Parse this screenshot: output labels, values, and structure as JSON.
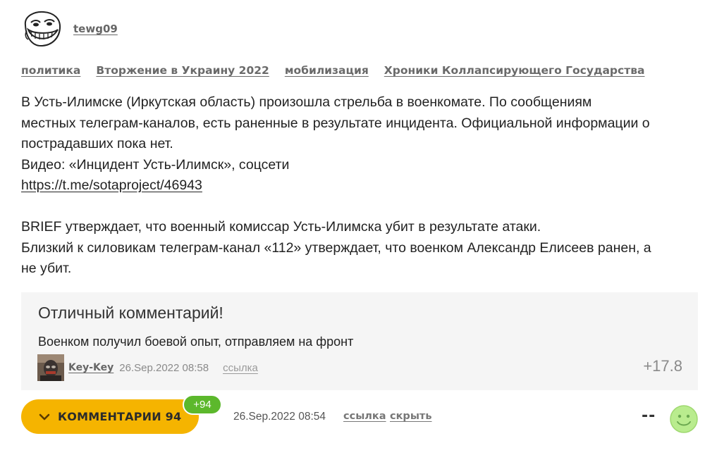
{
  "post": {
    "author": "tewg09",
    "tags": [
      "политика",
      "Вторжение в Украину 2022",
      "мобилизация",
      "Хроники Коллапсирующего Государства"
    ],
    "text_lines": [
      "В Усть-Илимске (Иркутская область) произошла стрельба в военкомате. По сообщениям",
      "местных телеграм-каналов, есть раненные в результате инцидента. Официальной информации о",
      "пострадавших пока нет.",
      "Видео: «Инцидент Усть-Илимск», соцсети"
    ],
    "link": "https://t.me/sotaproject/46943",
    "text_lines_2": [
      "BRIEF утверждает, что военный комиссар Усть-Илимска убит в результате атаки.",
      "Близкий к силовикам телеграм-канал «112» утверждает, что военком Александр Елисеев ранен, а",
      "не убит."
    ],
    "date": "26.Sep.2022 08:54",
    "link_label": "ссылка",
    "hide_label": "скрыть",
    "score": "--"
  },
  "best_comment": {
    "title": "Отличный комментарий!",
    "text": "Военком получил боевой опыт, отправляем на фронт",
    "user": "Key-Key",
    "date": "26.Sep.2022 08:58",
    "link_label": "ссылка",
    "score": "+17.8"
  },
  "comments": {
    "label": "КОММЕНТАРИИ 94",
    "new_count": "+94"
  },
  "colors": {
    "accent": "#f5b400",
    "badge_green": "#5cb82c",
    "panel_bg": "#f5f5f5",
    "smile": "#b9ec8e"
  },
  "icons": {
    "author_avatar": "trollface-avatar",
    "comments_chevron": "chevron-down-icon",
    "rating": "smile-icon"
  }
}
